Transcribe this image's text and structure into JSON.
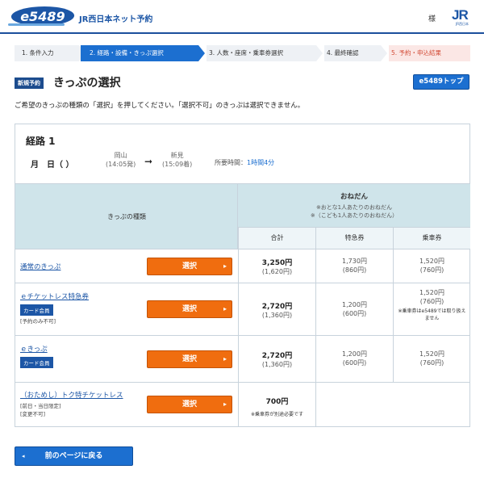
{
  "header": {
    "logo_text": "e5489",
    "site_title": "JR西日本ネット予約",
    "user_suffix": "様",
    "jr_mark": "JR",
    "jr_sub": "JR西日本"
  },
  "steps": [
    {
      "label": "1. 条件入力"
    },
    {
      "label": "2. 経路・設備・きっぷ選択"
    },
    {
      "label": "3. 人数・座席・乗車券選択"
    },
    {
      "label": "4. 最終確認"
    },
    {
      "label": "5. 予約・申込結果"
    }
  ],
  "title_row": {
    "badge": "新規予約",
    "title": "きっぷの選択",
    "top_button": "e5489トップ"
  },
  "instruction": "ご希望のきっぷの種類の「選択」を押してください。「選択不可」のきっぷは選択できません。",
  "route": {
    "title": "経路 1",
    "date": "月　日（ ）",
    "from_station": "岡山",
    "from_time": "(14:05発)",
    "arrow": "➞",
    "to_station": "新見",
    "to_time": "(15:09着)",
    "duration_label": "所要時間：",
    "duration_value": "1時間4分"
  },
  "table": {
    "ticket_type_header": "きっぷの種類",
    "price_header": "おねだん",
    "price_note_1": "※おとな1人あたりのおねだん",
    "price_note_2": "※（こども1人あたりのおねだん）",
    "col_total": "合計",
    "col_express": "特急券",
    "col_fare": "乗車券",
    "select_label": "選択",
    "rows": [
      {
        "name": "通常のきっぷ",
        "total": "3,250円",
        "total_child": "(1,620円)",
        "express": "1,730円",
        "express_child": "(860円)",
        "fare": "1,520円",
        "fare_child": "(760円)"
      },
      {
        "name": "ｅチケットレス特急券",
        "badge": "カード会員",
        "note": "[予約のみ不可]",
        "total": "2,720円",
        "total_child": "(1,360円)",
        "express": "1,200円",
        "express_child": "(600円)",
        "fare": "1,520円",
        "fare_child": "(760円)",
        "fare_note": "※乗車券はe5489では取り扱えません"
      },
      {
        "name": "ｅきっぷ",
        "badge": "カード会員",
        "total": "2,720円",
        "total_child": "(1,360円)",
        "express": "1,200円",
        "express_child": "(600円)",
        "fare": "1,520円",
        "fare_child": "(760円)"
      },
      {
        "name": "（おためし）トク特チケットレス",
        "note1": "[前日・当日限定]",
        "note2": "[変更不可]",
        "total": "700円",
        "total_note": "※乗車券が別途必要です"
      }
    ]
  },
  "back_button": "前のページに戻る"
}
